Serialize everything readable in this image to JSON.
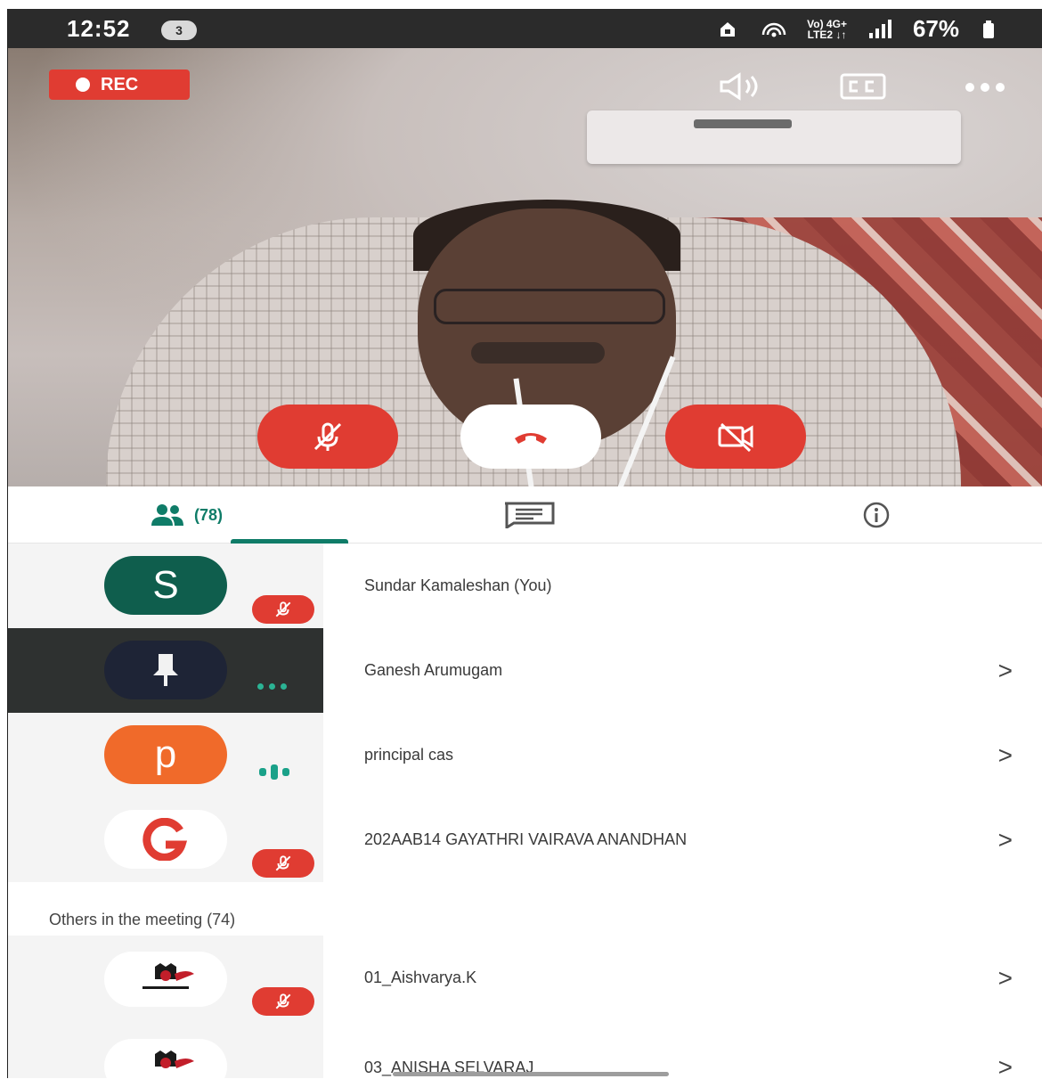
{
  "status_bar": {
    "time": "12:52",
    "notification_count": "3",
    "network_label_top": "Vo) 4G+",
    "network_label_bottom": "LTE2 ↓↑",
    "battery": "67%"
  },
  "call": {
    "rec_label": "REC",
    "icons": {
      "speaker": "speaker-icon",
      "captions": "cc-icon",
      "more": "more-icon",
      "mute": "mic-off-icon",
      "end_call": "phone-hangup-icon",
      "camera": "camera-off-icon"
    },
    "colors": {
      "record": "#e03c32",
      "accent": "#0f7c68"
    }
  },
  "tabs": {
    "people_count": "(78)",
    "icons": [
      "people-icon",
      "chat-icon",
      "info-icon"
    ]
  },
  "participants": [
    {
      "avatar_letter": "S",
      "avatar_color": "#0f5e4d",
      "name": "Sundar Kamaleshan (You)",
      "status": "muted",
      "has_chevron": false
    },
    {
      "avatar_letter": "",
      "avatar_color": "#1e2436",
      "name": "Ganesh Arumugam",
      "status": "connecting",
      "has_chevron": true
    },
    {
      "avatar_letter": "p",
      "avatar_color": "#f06a2a",
      "name": "principal cas",
      "status": "speaking",
      "has_chevron": true
    },
    {
      "avatar_letter": "G",
      "avatar_color": "#ffffff",
      "name": "202AAB14 GAYATHRI VAIRAVA ANANDHAN",
      "status": "muted",
      "has_chevron": true
    }
  ],
  "others": {
    "header": "Others in the meeting (74)",
    "participants": [
      {
        "name": "01_Aishvarya.K",
        "status": "muted"
      },
      {
        "name": "03_ANISHA SELVARAJ",
        "status": "muted"
      }
    ]
  },
  "chevron": ">"
}
